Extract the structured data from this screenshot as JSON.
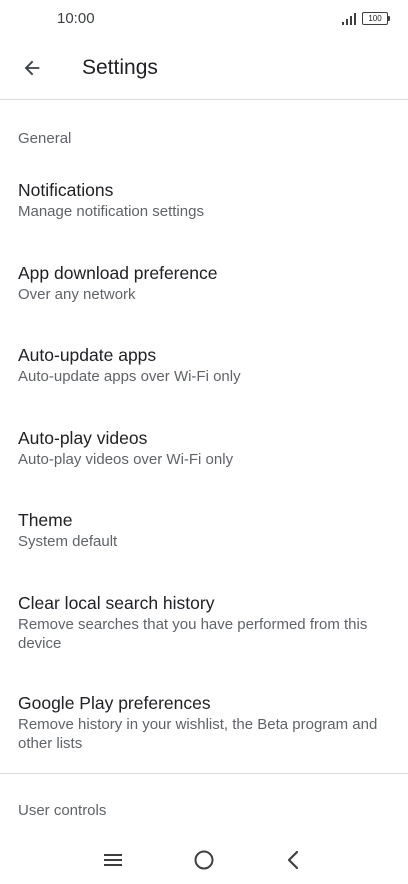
{
  "status_bar": {
    "time": "10:00",
    "battery": "100"
  },
  "app_bar": {
    "title": "Settings"
  },
  "sections": {
    "general": "General",
    "user_controls": "User controls"
  },
  "settings": [
    {
      "title": "Notifications",
      "subtitle": "Manage notification settings"
    },
    {
      "title": "App download preference",
      "subtitle": "Over any network"
    },
    {
      "title": "Auto-update apps",
      "subtitle": "Auto-update apps over Wi-Fi only"
    },
    {
      "title": "Auto-play videos",
      "subtitle": "Auto-play videos over Wi-Fi only"
    },
    {
      "title": "Theme",
      "subtitle": "System default"
    },
    {
      "title": "Clear local search history",
      "subtitle": "Remove searches that you have performed from this device"
    },
    {
      "title": "Google Play preferences",
      "subtitle": "Remove history in your wishlist, the Beta program and other lists"
    }
  ],
  "nav_bar": {
    "icons": [
      "menu-icon",
      "home-icon",
      "back-icon"
    ]
  },
  "colors": {
    "primary_text": "#202124",
    "secondary_text": "#5f6368",
    "divider": "#dadce0"
  }
}
